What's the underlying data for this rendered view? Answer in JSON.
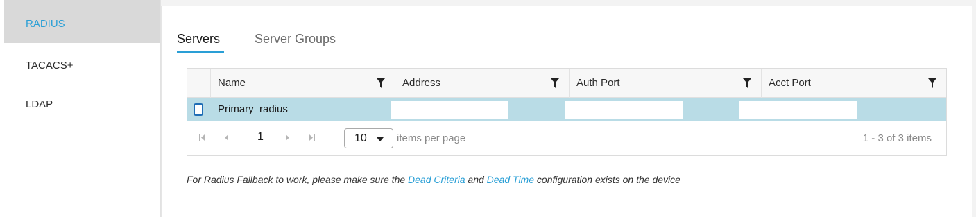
{
  "sidebar": {
    "items": [
      {
        "label": "RADIUS"
      },
      {
        "label": "TACACS+"
      },
      {
        "label": "LDAP"
      }
    ]
  },
  "tabs": [
    {
      "label": "Servers"
    },
    {
      "label": "Server Groups"
    }
  ],
  "grid": {
    "columns": [
      "Name",
      "Address",
      "Auth Port",
      "Acct Port"
    ],
    "rows": [
      {
        "name": "Primary_radius",
        "address": "",
        "auth_port": "",
        "acct_port": ""
      }
    ],
    "pager": {
      "first_icon": "first-page-icon",
      "prev_icon": "prev-page-icon",
      "next_icon": "next-page-icon",
      "last_icon": "last-page-icon",
      "page": "1",
      "page_size": "10",
      "items_per_page_label": "items per page",
      "count_label": "1 - 3 of 3 items"
    }
  },
  "note": {
    "prefix": "For Radius Fallback to work, please make sure the",
    "link1": "Dead Criteria",
    "middle": "and",
    "link2": "Dead Time",
    "suffix": "configuration exists on the device"
  },
  "colors": {
    "accent": "#2a9fd6",
    "selected_row": "#b9dce6",
    "checkbox": "#1f6db5"
  }
}
